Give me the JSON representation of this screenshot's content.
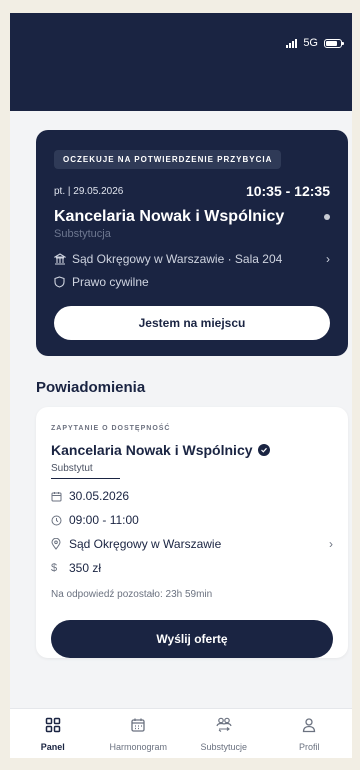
{
  "status_bar": {
    "network": "5G",
    "signal_icon": "signal-icon",
    "battery_icon": "battery-icon"
  },
  "appointment": {
    "badge": "OCZEKUJE NA POTWIERDZENIE PRZYBYCIA",
    "date": "pt. | 29.05.2026",
    "time": "10:35 - 12:35",
    "title": "Kancelaria Nowak i Wspólnicy",
    "subtitle": "Substytucja",
    "location": "Sąd Okręgowy w Warszawie · Sala 204",
    "category": "Prawo cywilne",
    "button": "Jestem na miejscu"
  },
  "notifications": {
    "section_title": "Powiadomienia",
    "card": {
      "label": "ZAPYTANIE O DOSTĘPNOŚĆ",
      "title": "Kancelaria Nowak i Wspólnicy",
      "subtitle": "Substytut",
      "date": "30.05.2026",
      "time": "09:00 - 11:00",
      "location": "Sąd Okręgowy w Warszawie",
      "price": "350 zł",
      "deadline": "Na odpowiedź pozostało: 23h 59min",
      "button": "Wyślij ofertę"
    }
  },
  "tabs": [
    {
      "label": "Panel",
      "icon": "grid-icon",
      "active": true
    },
    {
      "label": "Harmonogram",
      "icon": "calendar-icon",
      "active": false
    },
    {
      "label": "Substytucje",
      "icon": "people-swap-icon",
      "active": false
    },
    {
      "label": "Profil",
      "icon": "user-icon",
      "active": false
    }
  ],
  "colors": {
    "primary": "#1a2442",
    "background": "#f3f4f6",
    "muted": "#6b7280"
  }
}
